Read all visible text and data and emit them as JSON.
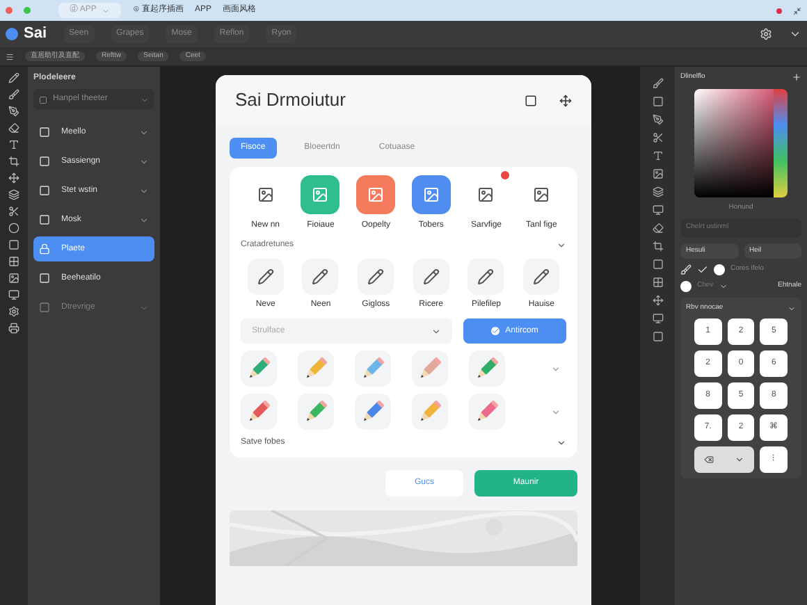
{
  "system_bar": {
    "app_menu": "ⓓ APP",
    "items": [
      "⊙ 直起序插画",
      "APP",
      "画面风格"
    ]
  },
  "toolbar": {
    "app_name": "Sai",
    "buttons": [
      "Seen",
      "Grapes",
      "Mose",
      "Reflon",
      "Ryon"
    ]
  },
  "sub_toolbar": {
    "items": [
      "直居助引及直配",
      "Refttw",
      "Seitan",
      "Ceet"
    ]
  },
  "left_panel": {
    "title": "Plodeleere",
    "dropdown": "Hanpel theeter",
    "items": [
      {
        "label": "Meello",
        "selected": false,
        "disabled": false,
        "expandable": true
      },
      {
        "label": "Sassiengn",
        "selected": false,
        "disabled": false,
        "expandable": true
      },
      {
        "label": "Stet wstin",
        "selected": false,
        "disabled": false,
        "expandable": true
      },
      {
        "label": "Mosk",
        "selected": false,
        "disabled": false,
        "expandable": true
      },
      {
        "label": "Plaete",
        "selected": true,
        "disabled": false,
        "expandable": false
      },
      {
        "label": "Beeheatilo",
        "selected": false,
        "disabled": false,
        "expandable": false
      },
      {
        "label": "Dtrevrige",
        "selected": false,
        "disabled": true,
        "expandable": true
      }
    ]
  },
  "dialog": {
    "title": "Sai Drmoiutur",
    "tabs": [
      {
        "label": "Fisoce",
        "selected": true
      },
      {
        "label": "Bloeertdn",
        "selected": false
      },
      {
        "label": "Cotuaase",
        "selected": false
      }
    ],
    "apps": [
      {
        "label": "New nn",
        "color": "#ffffff",
        "badge": false
      },
      {
        "label": "Fioiaue",
        "color": "#2fbf8f",
        "badge": false
      },
      {
        "label": "Oopelty",
        "color": "#f47b5e",
        "badge": false
      },
      {
        "label": "Tobers",
        "color": "#4f8ef0",
        "badge": false
      },
      {
        "label": "Sarvfige",
        "color": "#ffffff",
        "badge": true
      },
      {
        "label": "Tanl fige",
        "color": "#ffffff",
        "badge": false
      }
    ],
    "section": "Cratadretunes",
    "tools": [
      "Neve",
      "Neen",
      "Gigloss",
      "Ricere",
      "Pilefilep",
      "Hauise"
    ],
    "select_placeholder": "Strulface",
    "action_button": "Antircom",
    "pencils": [
      {
        "color": "#2fae7a"
      },
      {
        "color": "#f0b43a"
      },
      {
        "color": "#6bb5ea"
      },
      {
        "color": "#e2a99a"
      },
      {
        "color": "#2fae6a"
      },
      {
        "color": "#e25a5a"
      },
      {
        "color": "#3cb860"
      },
      {
        "color": "#4a86e8"
      },
      {
        "color": "#f2b23e"
      },
      {
        "color": "#ec6b8c"
      }
    ],
    "footer_section": "Satve fobes",
    "cancel": "Gucs",
    "confirm": "Maunir"
  },
  "right_panel": {
    "title": "Dlinelflo",
    "color_label": "Honund",
    "field": "Chelrt ustinml",
    "mode": "Hesuli",
    "value": "Heil",
    "option": "Cores ifelo",
    "select": "Chev",
    "toggle": "Ehtnale",
    "keypad_title": "Rbv nnocae",
    "keys": [
      "1",
      "2",
      "5",
      "2",
      "0",
      "6",
      "8",
      "5",
      "8",
      "7.",
      "2",
      "⌘"
    ],
    "last_key": "⁝"
  }
}
